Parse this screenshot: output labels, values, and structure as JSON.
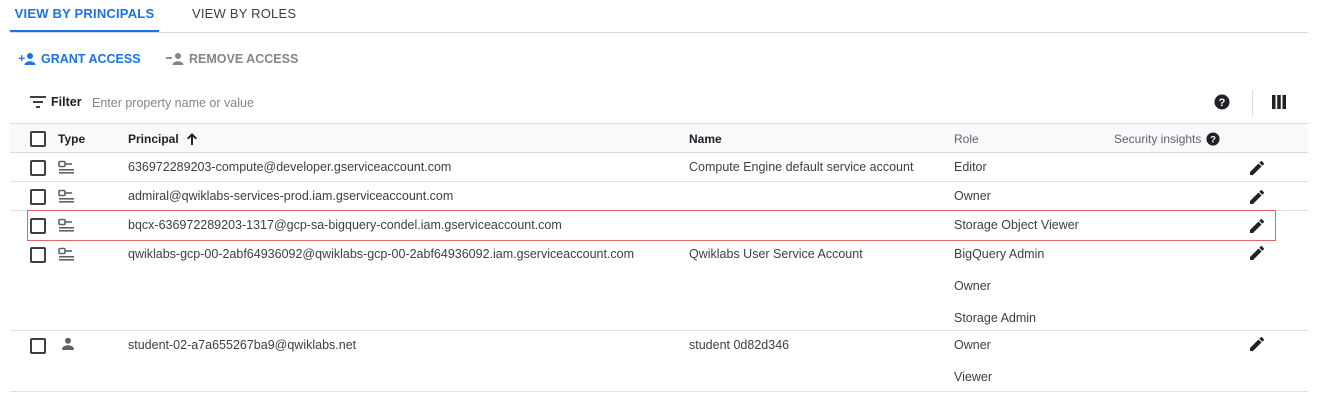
{
  "tabs": [
    {
      "label": "VIEW BY PRINCIPALS",
      "active": true
    },
    {
      "label": "VIEW BY ROLES",
      "active": false
    }
  ],
  "actions": {
    "grant_label": "GRANT ACCESS",
    "remove_label": "REMOVE ACCESS"
  },
  "filter": {
    "label": "Filter",
    "placeholder": "Enter property name or value"
  },
  "table": {
    "headers": {
      "type": "Type",
      "principal": "Principal",
      "name": "Name",
      "role": "Role",
      "security": "Security insights"
    },
    "sort": {
      "column": "Principal",
      "direction": "ascending"
    },
    "rows": [
      {
        "type": "service-account",
        "principal": "636972289203-compute@developer.gserviceaccount.com",
        "name": "Compute Engine default service account",
        "roles": [
          "Editor"
        ]
      },
      {
        "type": "service-account",
        "principal": "admiral@qwiklabs-services-prod.iam.gserviceaccount.com",
        "name": "",
        "roles": [
          "Owner"
        ]
      },
      {
        "type": "service-account",
        "principal": "bqcx-636972289203-1317@gcp-sa-bigquery-condel.iam.gserviceaccount.com",
        "name": "",
        "roles": [
          "Storage Object Viewer"
        ],
        "highlighted": true
      },
      {
        "type": "service-account",
        "principal": "qwiklabs-gcp-00-2abf64936092@qwiklabs-gcp-00-2abf64936092.iam.gserviceaccount.com",
        "name": "Qwiklabs User Service Account",
        "roles": [
          "BigQuery Admin",
          "Owner",
          "Storage Admin"
        ]
      },
      {
        "type": "user",
        "principal": "student-02-a7a655267ba9@qwiklabs.net",
        "name": "student 0d82d346",
        "roles": [
          "Owner",
          "Viewer"
        ]
      }
    ]
  },
  "colors": {
    "accent": "#1a73e8",
    "highlight_border": "#e06666"
  },
  "icons": {
    "grant": "person-add-icon",
    "remove": "person-remove-icon",
    "filter": "filter-icon",
    "help": "help-icon",
    "columns": "columns-icon",
    "sort": "arrow-up-icon",
    "service_account": "service-account-icon",
    "user": "person-icon",
    "edit": "pencil-icon"
  }
}
